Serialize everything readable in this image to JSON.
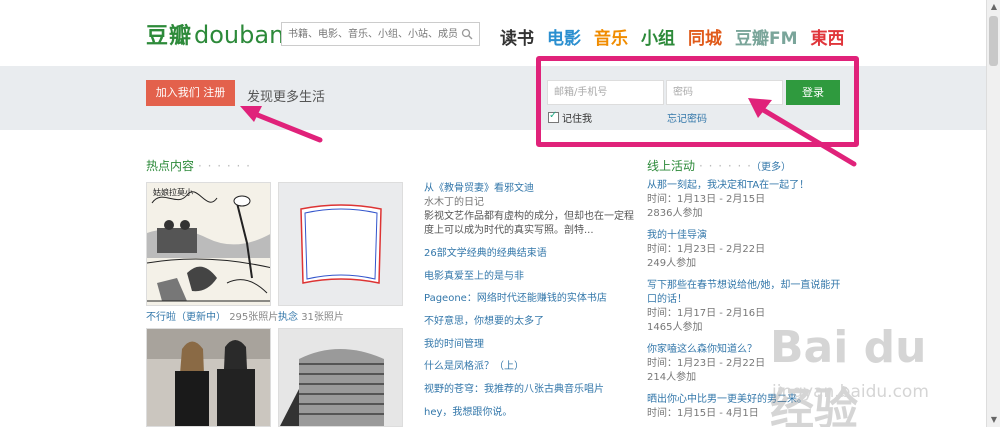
{
  "header": {
    "logo_cn": "豆瓣",
    "logo_en": "douban",
    "search_placeholder": "书籍、电影、音乐、小组、小站、成员",
    "nav": [
      {
        "label": "读书",
        "color": "#333333"
      },
      {
        "label": "电影",
        "color": "#2b8fd0"
      },
      {
        "label": "音乐",
        "color": "#f08c00"
      },
      {
        "label": "小组",
        "color": "#2d8a3a"
      },
      {
        "label": "同城",
        "color": "#e05a1a"
      },
      {
        "label": "豆瓣FM",
        "color": "#7aa59a"
      },
      {
        "label": "東西",
        "color": "#e0353a"
      }
    ]
  },
  "band": {
    "join_label": "加入我们 注册",
    "discover": "发现更多生活"
  },
  "login": {
    "email_placeholder": "邮箱/手机号",
    "password_placeholder": "密码",
    "submit_label": "登录",
    "remember_label": "记住我",
    "forgot_label": "忘记密码",
    "highlight_color": "#e0227a"
  },
  "hot": {
    "title": "热点内容",
    "dots": "· · · · · ·",
    "albums": [
      {
        "name": "不行啦（更新中）",
        "count": "295张照片"
      },
      {
        "name": "执念",
        "count": "31张照片"
      }
    ],
    "articles": [
      {
        "title": "从《教骨贸妻》看邪文迪",
        "source": "水木丁的日记",
        "desc": "影视文艺作品都有虚构的成分，但却也在一定程度上可以成为时代的真实写照。剖特..."
      },
      {
        "title": "26部文学经典的经典结束语"
      },
      {
        "title": "电影真爱至上的是与非"
      },
      {
        "title": "Pageone：网络时代还能赚钱的实体书店"
      },
      {
        "title": "不好意思，你想要的太多了"
      },
      {
        "title": "我的时间管理"
      },
      {
        "title": "什么是凤格派？（上）"
      },
      {
        "title": "视野的苍穹：我推荐的八张古典音乐唱片"
      },
      {
        "title": "hey，我想跟你说。"
      }
    ]
  },
  "events": {
    "title": "线上活动",
    "dots": "· · · · · ·",
    "more": "（更多）",
    "items": [
      {
        "title": "从那一刻起，我决定和TA在一起了！",
        "time": "时间：1月13日 - 2月15日",
        "count": "2836人参加"
      },
      {
        "title": "我的十佳导演",
        "time": "时间：1月23日 - 2月22日",
        "count": "249人参加"
      },
      {
        "title": "写下那些在春节想说给他/她，却一直说能开口的话！",
        "time": "时间：1月17日 - 2月16日",
        "count": "1465人参加"
      },
      {
        "title": "你家嗑这么森你知道么？",
        "time": "时间：1月23日 - 2月22日",
        "count": "214人参加"
      },
      {
        "title": "晒出你心中比男一更美好的男二来。",
        "time": "时间：1月15日 - 4月1日",
        "count": ""
      }
    ]
  },
  "watermark": {
    "text": "Bai du 经验",
    "url": "jingyan.baidu.com"
  }
}
